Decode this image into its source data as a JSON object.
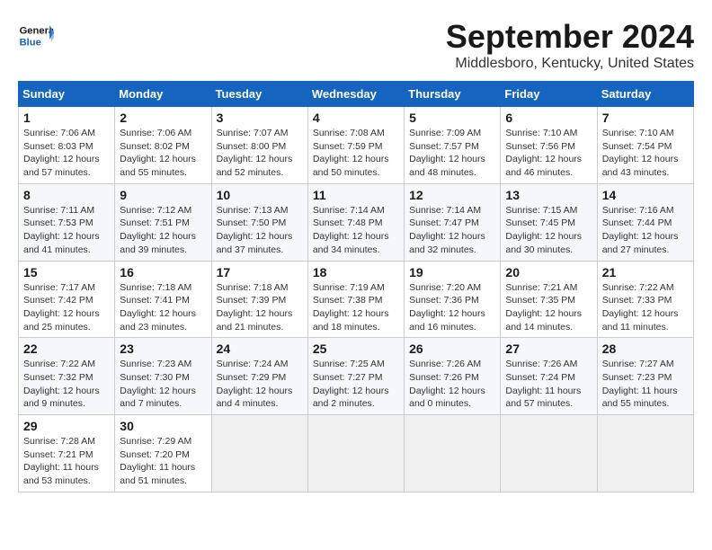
{
  "header": {
    "logo_line1": "General",
    "logo_line2": "Blue",
    "month": "September 2024",
    "location": "Middlesboro, Kentucky, United States"
  },
  "weekdays": [
    "Sunday",
    "Monday",
    "Tuesday",
    "Wednesday",
    "Thursday",
    "Friday",
    "Saturday"
  ],
  "weeks": [
    [
      {
        "day": "1",
        "sunrise": "7:06 AM",
        "sunset": "8:03 PM",
        "daylight": "12 hours and 57 minutes."
      },
      {
        "day": "2",
        "sunrise": "7:06 AM",
        "sunset": "8:02 PM",
        "daylight": "12 hours and 55 minutes."
      },
      {
        "day": "3",
        "sunrise": "7:07 AM",
        "sunset": "8:00 PM",
        "daylight": "12 hours and 52 minutes."
      },
      {
        "day": "4",
        "sunrise": "7:08 AM",
        "sunset": "7:59 PM",
        "daylight": "12 hours and 50 minutes."
      },
      {
        "day": "5",
        "sunrise": "7:09 AM",
        "sunset": "7:57 PM",
        "daylight": "12 hours and 48 minutes."
      },
      {
        "day": "6",
        "sunrise": "7:10 AM",
        "sunset": "7:56 PM",
        "daylight": "12 hours and 46 minutes."
      },
      {
        "day": "7",
        "sunrise": "7:10 AM",
        "sunset": "7:54 PM",
        "daylight": "12 hours and 43 minutes."
      }
    ],
    [
      {
        "day": "8",
        "sunrise": "7:11 AM",
        "sunset": "7:53 PM",
        "daylight": "12 hours and 41 minutes."
      },
      {
        "day": "9",
        "sunrise": "7:12 AM",
        "sunset": "7:51 PM",
        "daylight": "12 hours and 39 minutes."
      },
      {
        "day": "10",
        "sunrise": "7:13 AM",
        "sunset": "7:50 PM",
        "daylight": "12 hours and 37 minutes."
      },
      {
        "day": "11",
        "sunrise": "7:14 AM",
        "sunset": "7:48 PM",
        "daylight": "12 hours and 34 minutes."
      },
      {
        "day": "12",
        "sunrise": "7:14 AM",
        "sunset": "7:47 PM",
        "daylight": "12 hours and 32 minutes."
      },
      {
        "day": "13",
        "sunrise": "7:15 AM",
        "sunset": "7:45 PM",
        "daylight": "12 hours and 30 minutes."
      },
      {
        "day": "14",
        "sunrise": "7:16 AM",
        "sunset": "7:44 PM",
        "daylight": "12 hours and 27 minutes."
      }
    ],
    [
      {
        "day": "15",
        "sunrise": "7:17 AM",
        "sunset": "7:42 PM",
        "daylight": "12 hours and 25 minutes."
      },
      {
        "day": "16",
        "sunrise": "7:18 AM",
        "sunset": "7:41 PM",
        "daylight": "12 hours and 23 minutes."
      },
      {
        "day": "17",
        "sunrise": "7:18 AM",
        "sunset": "7:39 PM",
        "daylight": "12 hours and 21 minutes."
      },
      {
        "day": "18",
        "sunrise": "7:19 AM",
        "sunset": "7:38 PM",
        "daylight": "12 hours and 18 minutes."
      },
      {
        "day": "19",
        "sunrise": "7:20 AM",
        "sunset": "7:36 PM",
        "daylight": "12 hours and 16 minutes."
      },
      {
        "day": "20",
        "sunrise": "7:21 AM",
        "sunset": "7:35 PM",
        "daylight": "12 hours and 14 minutes."
      },
      {
        "day": "21",
        "sunrise": "7:22 AM",
        "sunset": "7:33 PM",
        "daylight": "12 hours and 11 minutes."
      }
    ],
    [
      {
        "day": "22",
        "sunrise": "7:22 AM",
        "sunset": "7:32 PM",
        "daylight": "12 hours and 9 minutes."
      },
      {
        "day": "23",
        "sunrise": "7:23 AM",
        "sunset": "7:30 PM",
        "daylight": "12 hours and 7 minutes."
      },
      {
        "day": "24",
        "sunrise": "7:24 AM",
        "sunset": "7:29 PM",
        "daylight": "12 hours and 4 minutes."
      },
      {
        "day": "25",
        "sunrise": "7:25 AM",
        "sunset": "7:27 PM",
        "daylight": "12 hours and 2 minutes."
      },
      {
        "day": "26",
        "sunrise": "7:26 AM",
        "sunset": "7:26 PM",
        "daylight": "12 hours and 0 minutes."
      },
      {
        "day": "27",
        "sunrise": "7:26 AM",
        "sunset": "7:24 PM",
        "daylight": "11 hours and 57 minutes."
      },
      {
        "day": "28",
        "sunrise": "7:27 AM",
        "sunset": "7:23 PM",
        "daylight": "11 hours and 55 minutes."
      }
    ],
    [
      {
        "day": "29",
        "sunrise": "7:28 AM",
        "sunset": "7:21 PM",
        "daylight": "11 hours and 53 minutes."
      },
      {
        "day": "30",
        "sunrise": "7:29 AM",
        "sunset": "7:20 PM",
        "daylight": "11 hours and 51 minutes."
      },
      null,
      null,
      null,
      null,
      null
    ]
  ]
}
